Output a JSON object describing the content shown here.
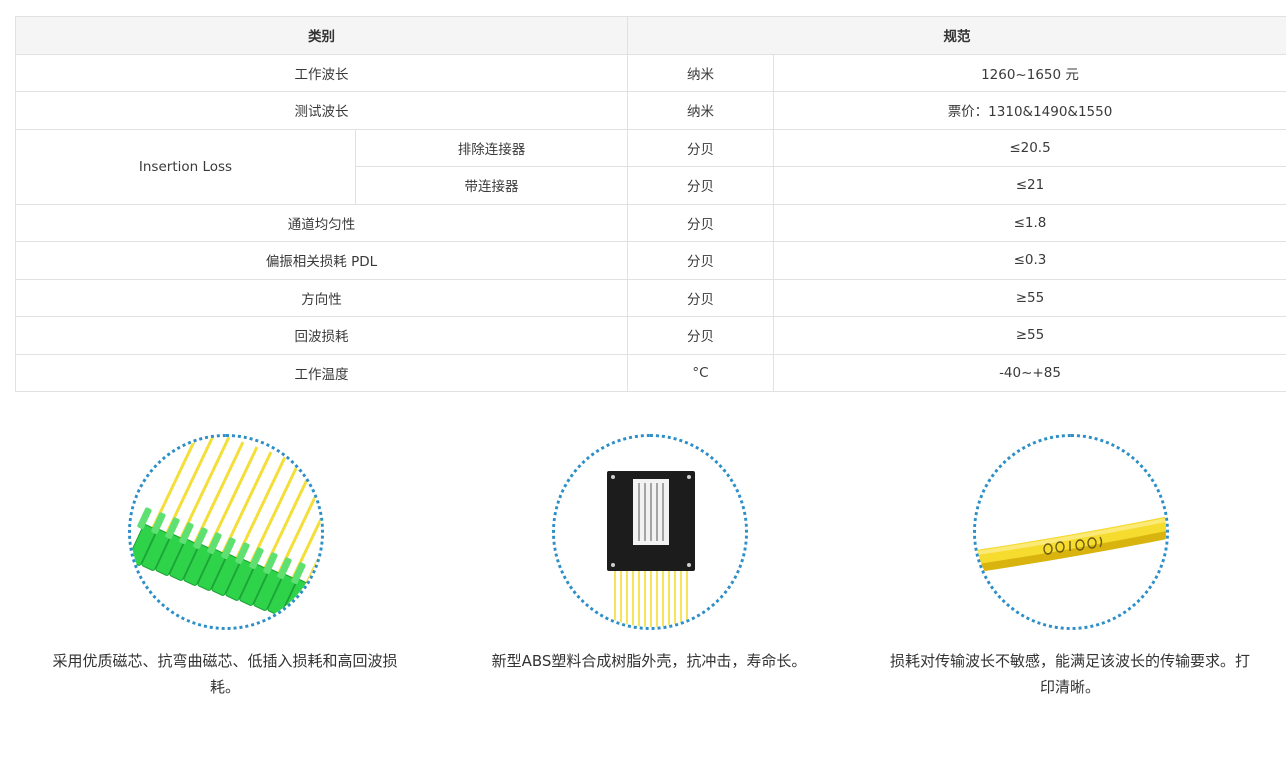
{
  "table": {
    "headers": {
      "category": "类别",
      "spec": "规范"
    },
    "rows": {
      "wavelength": {
        "label": "工作波长",
        "unit": "纳米",
        "value": "1260~1650 元"
      },
      "test_wavelength": {
        "label": "测试波长",
        "unit": "纳米",
        "value": "票价：1310&1490&1550"
      },
      "insertion_loss": {
        "label": "Insertion Loss",
        "without_connector": {
          "label": "排除连接器",
          "unit": "分贝",
          "value": "≤20.5"
        },
        "with_connector": {
          "label": "带连接器",
          "unit": "分贝",
          "value": "≤21"
        }
      },
      "uniformity": {
        "label": "通道均匀性",
        "unit": "分贝",
        "value": "≤1.8"
      },
      "pdl": {
        "label": "偏振相关损耗 PDL",
        "unit": "分贝",
        "value": "≤0.3"
      },
      "directivity": {
        "label": "方向性",
        "unit": "分贝",
        "value": "≥55"
      },
      "return_loss": {
        "label": "回波损耗",
        "unit": "分贝",
        "value": "≥55"
      },
      "temperature": {
        "label": "工作温度",
        "unit": "°C",
        "value": "-40~+85"
      }
    }
  },
  "features": [
    {
      "icon": "sc-connector-fan-icon",
      "caption_line1": "采用优质磁芯、抗弯曲磁芯、低插入损耗和高回波损",
      "caption_line2": "耗。"
    },
    {
      "icon": "abs-splitter-box-icon",
      "caption_line1": "新型ABS塑料合成树脂外壳，抗冲击，寿命长。",
      "caption_line2": ""
    },
    {
      "icon": "yellow-fiber-cable-icon",
      "caption_line1": "损耗对传输波长不敏感，能满足该波长的传输要求。打",
      "caption_line2": "印清晰。"
    }
  ],
  "colors": {
    "header_bg": "#f5f5f5",
    "border": "#e1e1e1",
    "circle_border": "#2d8fc7",
    "connector_green": "#2fd34a",
    "fiber_yellow": "#f2d21e"
  }
}
